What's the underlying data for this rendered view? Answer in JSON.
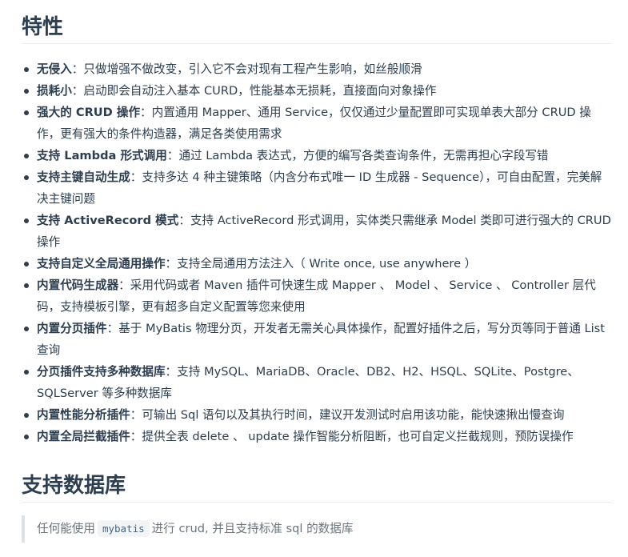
{
  "features": {
    "title": "特性",
    "items": [
      {
        "term": "无侵入",
        "sep": "：",
        "desc": "只做增强不做改变，引入它不会对现有工程产生影响，如丝般顺滑"
      },
      {
        "term": "损耗小",
        "sep": "：",
        "desc": "启动即会自动注入基本 CURD，性能基本无损耗，直接面向对象操作"
      },
      {
        "term": "强大的 CRUD 操作",
        "sep": "：",
        "desc": "内置通用 Mapper、通用 Service，仅仅通过少量配置即可实现单表大部分 CRUD 操作，更有强大的条件构造器，满足各类使用需求"
      },
      {
        "term": "支持 Lambda 形式调用",
        "sep": "：",
        "desc": "通过 Lambda 表达式，方便的编写各类查询条件，无需再担心字段写错"
      },
      {
        "term": "支持主键自动生成",
        "sep": "：",
        "desc": "支持多达 4 种主键策略（内含分布式唯一 ID 生成器 - Sequence），可自由配置，完美解决主键问题"
      },
      {
        "term": "支持 ActiveRecord 模式",
        "sep": "：",
        "desc": "支持 ActiveRecord 形式调用，实体类只需继承 Model 类即可进行强大的 CRUD 操作"
      },
      {
        "term": "支持自定义全局通用操作",
        "sep": "：",
        "desc": "支持全局通用方法注入（ Write once, use anywhere ）"
      },
      {
        "term": "内置代码生成器",
        "sep": "：",
        "desc": "采用代码或者 Maven 插件可快速生成 Mapper 、 Model 、 Service 、 Controller 层代码，支持模板引擎，更有超多自定义配置等您来使用"
      },
      {
        "term": "内置分页插件",
        "sep": "：",
        "desc": "基于 MyBatis 物理分页，开发者无需关心具体操作，配置好插件之后，写分页等同于普通 List 查询"
      },
      {
        "term": "分页插件支持多种数据库",
        "sep": "：",
        "desc": "支持 MySQL、MariaDB、Oracle、DB2、H2、HSQL、SQLite、Postgre、SQLServer 等多种数据库"
      },
      {
        "term": "内置性能分析插件",
        "sep": "：",
        "desc": "可输出 Sql 语句以及其执行时间，建议开发测试时启用该功能，能快速揪出慢查询"
      },
      {
        "term": "内置全局拦截插件",
        "sep": "：",
        "desc": "提供全表 delete 、 update 操作智能分析阻断，也可自定义拦截规则，预防误操作"
      }
    ]
  },
  "databases": {
    "title": "支持数据库",
    "quote_before": "任何能使用",
    "quote_code": "mybatis",
    "quote_after": "进行 crud, 并且支持标准 sql 的数据库"
  }
}
